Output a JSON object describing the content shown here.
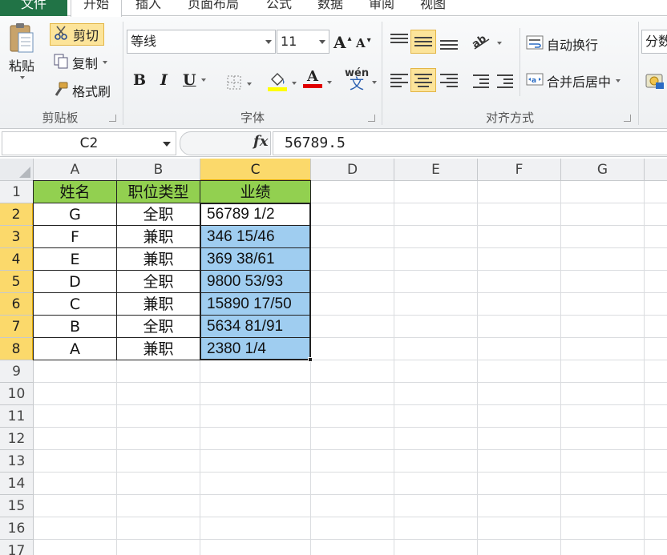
{
  "tabs": [
    {
      "id": "file",
      "label": "文件"
    },
    {
      "id": "home",
      "label": "开始"
    },
    {
      "id": "insert",
      "label": "插入"
    },
    {
      "id": "layout",
      "label": "页面布局"
    },
    {
      "id": "formula",
      "label": "公式"
    },
    {
      "id": "data",
      "label": "数据"
    },
    {
      "id": "review",
      "label": "审阅"
    },
    {
      "id": "view",
      "label": "视图"
    }
  ],
  "ribbon": {
    "clipboard": {
      "label": "剪贴板",
      "paste": "粘贴",
      "cut": "剪切",
      "copy": "复制",
      "format_painter": "格式刷"
    },
    "font": {
      "label": "字体",
      "font_name": "等线",
      "font_size": "11",
      "bold": "B",
      "italic": "I",
      "underline": "U",
      "font_color_letter": "A",
      "phonetic": "wén",
      "phonetic_char": "文",
      "grow": "A",
      "shrink": "A"
    },
    "alignment": {
      "label": "对齐方式",
      "wrap_text": "自动换行",
      "merge_center": "合并后居中"
    },
    "number": {
      "format": "分数"
    }
  },
  "formula_bar": {
    "name_box": "C2",
    "fx": "fx",
    "value": "56789.5"
  },
  "sheet": {
    "columns": [
      "A",
      "B",
      "C",
      "D",
      "E",
      "F",
      "G"
    ],
    "rows": [
      "1",
      "2",
      "3",
      "4",
      "5",
      "6",
      "7",
      "8",
      "9",
      "10",
      "11",
      "12",
      "13",
      "14",
      "15",
      "16",
      "17"
    ],
    "cells": [
      [
        "姓名",
        "职位类型",
        "业绩"
      ],
      [
        "G",
        "全职",
        "56789   1/2"
      ],
      [
        "F",
        "兼职",
        "346 15/46"
      ],
      [
        "E",
        "兼职",
        "369 38/61"
      ],
      [
        "D",
        "全职",
        "9800 53/93"
      ],
      [
        "C",
        "兼职",
        "15890 17/50"
      ],
      [
        "B",
        "全职",
        "5634 81/91"
      ],
      [
        "A",
        "兼职",
        "2380   1/4"
      ]
    ]
  },
  "colors": {
    "header_fill": "#92d050",
    "selection_fill": "#9fcdf0",
    "selected_header": "#fbd96b",
    "file_tab": "#217346"
  }
}
